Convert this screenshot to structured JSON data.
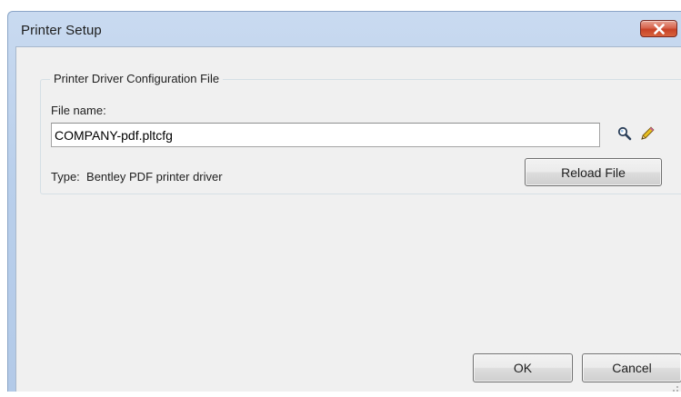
{
  "window": {
    "title": "Printer Setup"
  },
  "group": {
    "legend": "Printer Driver Configuration File"
  },
  "file": {
    "label": "File name:",
    "value": "COMPANY-pdf.pltcfg"
  },
  "type_info": {
    "prefix": "Type:",
    "value": "Bentley PDF printer driver"
  },
  "buttons": {
    "reload": "Reload File",
    "ok": "OK",
    "cancel": "Cancel"
  },
  "icons": {
    "close": "close-icon",
    "browse": "magnifier-icon",
    "edit": "pencil-icon"
  },
  "colors": {
    "title_bar": "#b9cfeb",
    "close_button": "#c74227",
    "dialog_background": "#f0f0f0",
    "pencil": "#e8c020"
  }
}
